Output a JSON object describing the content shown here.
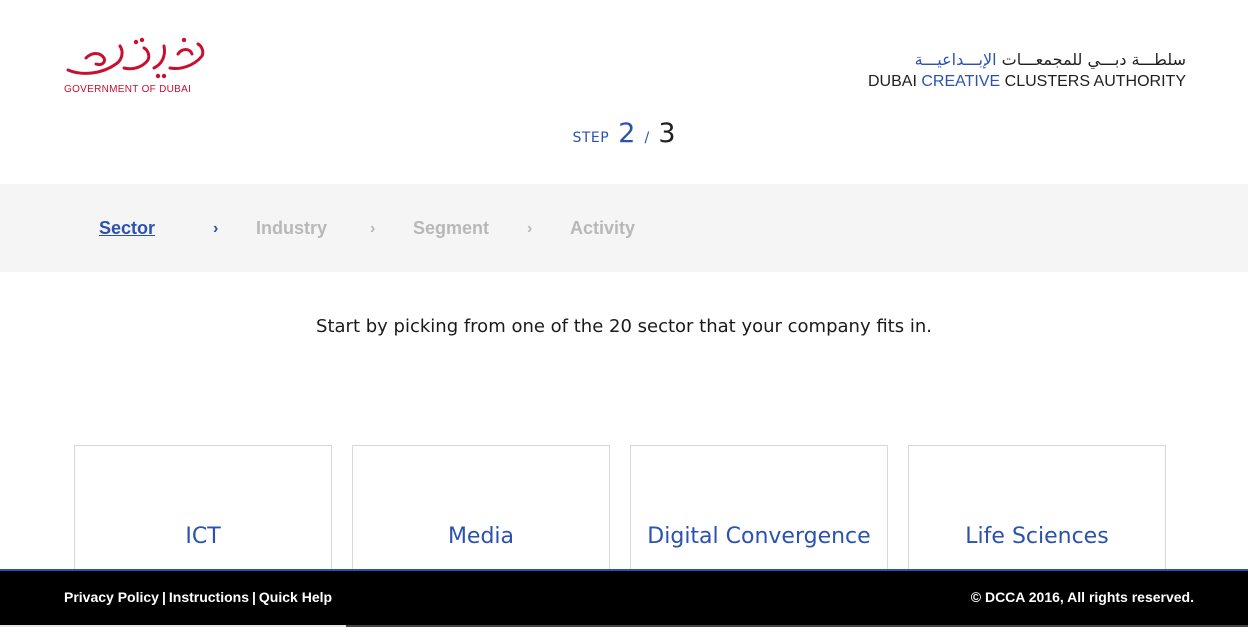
{
  "header": {
    "gov_logo_text": "GOVERNMENT OF DUBAI",
    "dcca_arabic_dark": "سلطـــة دبـــي للمجمعـــات",
    "dcca_arabic_blue": "الإبـــداعيـــة",
    "dcca_en_1": "DUBAI",
    "dcca_en_2": "CREATIVE",
    "dcca_en_3": "CLUSTERS AUTHORITY"
  },
  "step": {
    "label": "STEP",
    "current": "2",
    "separator": "/",
    "total": "3"
  },
  "breadcrumb": {
    "items": [
      {
        "label": "Sector"
      },
      {
        "label": "Industry"
      },
      {
        "label": "Segment"
      },
      {
        "label": "Activity"
      }
    ],
    "chevron": "›"
  },
  "intro_text": "Start by picking from one of the 20 sector that your company fits in.",
  "sectors": [
    {
      "label": "ICT"
    },
    {
      "label": "Media"
    },
    {
      "label": "Digital Convergence"
    },
    {
      "label": "Life Sciences"
    }
  ],
  "footer": {
    "privacy": "Privacy Policy",
    "instructions": "Instructions",
    "quick_help": "Quick Help",
    "separator": "|",
    "copyright": "© DCCA 2016, All rights reserved."
  },
  "colors": {
    "accent": "#2b52b0",
    "gov_red": "#c8102e",
    "muted": "#b8b8b8",
    "footer_bg": "#000000"
  }
}
